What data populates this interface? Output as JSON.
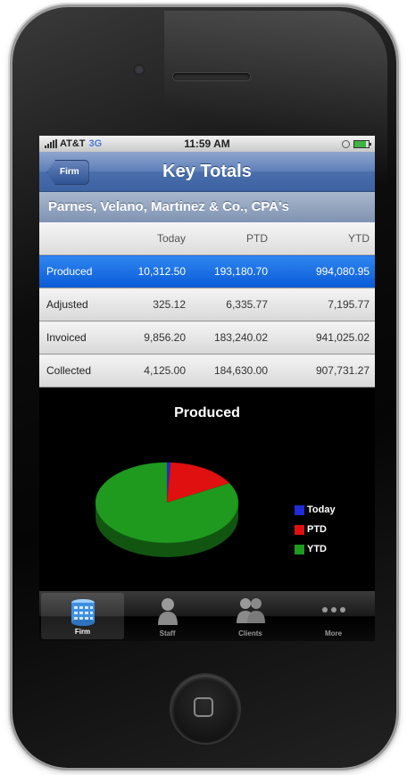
{
  "status": {
    "carrier": "AT&T",
    "network": "3G",
    "time": "11:59 AM"
  },
  "nav": {
    "back_label": "Firm",
    "title": "Key Totals"
  },
  "firm_name": "Parnes, Velano, Martinez & Co., CPA's",
  "table": {
    "headers": [
      "",
      "Today",
      "PTD",
      "YTD"
    ],
    "rows": [
      {
        "label": "Produced",
        "today": "10,312.50",
        "ptd": "193,180.70",
        "ytd": "994,080.95",
        "selected": true
      },
      {
        "label": "Adjusted",
        "today": "325.12",
        "ptd": "6,335.77",
        "ytd": "7,195.77"
      },
      {
        "label": "Invoiced",
        "today": "9,856.20",
        "ptd": "183,240.02",
        "ytd": "941,025.02"
      },
      {
        "label": "Collected",
        "today": "4,125.00",
        "ptd": "184,630.00",
        "ytd": "907,731.27"
      }
    ]
  },
  "chart_data": {
    "type": "pie",
    "title": "Produced",
    "labels": [
      "Today",
      "PTD",
      "YTD"
    ],
    "values": [
      10312.5,
      193180.7,
      994080.95
    ],
    "colors": [
      "#1f2bd6",
      "#e01010",
      "#1f9a1f"
    ],
    "legend": "right"
  },
  "tabbar": {
    "tabs": [
      {
        "label": "Firm",
        "icon": "database-icon",
        "active": true
      },
      {
        "label": "Staff",
        "icon": "person-icon"
      },
      {
        "label": "Clients",
        "icon": "group-icon"
      },
      {
        "label": "More",
        "icon": "ellipsis-icon"
      }
    ]
  }
}
